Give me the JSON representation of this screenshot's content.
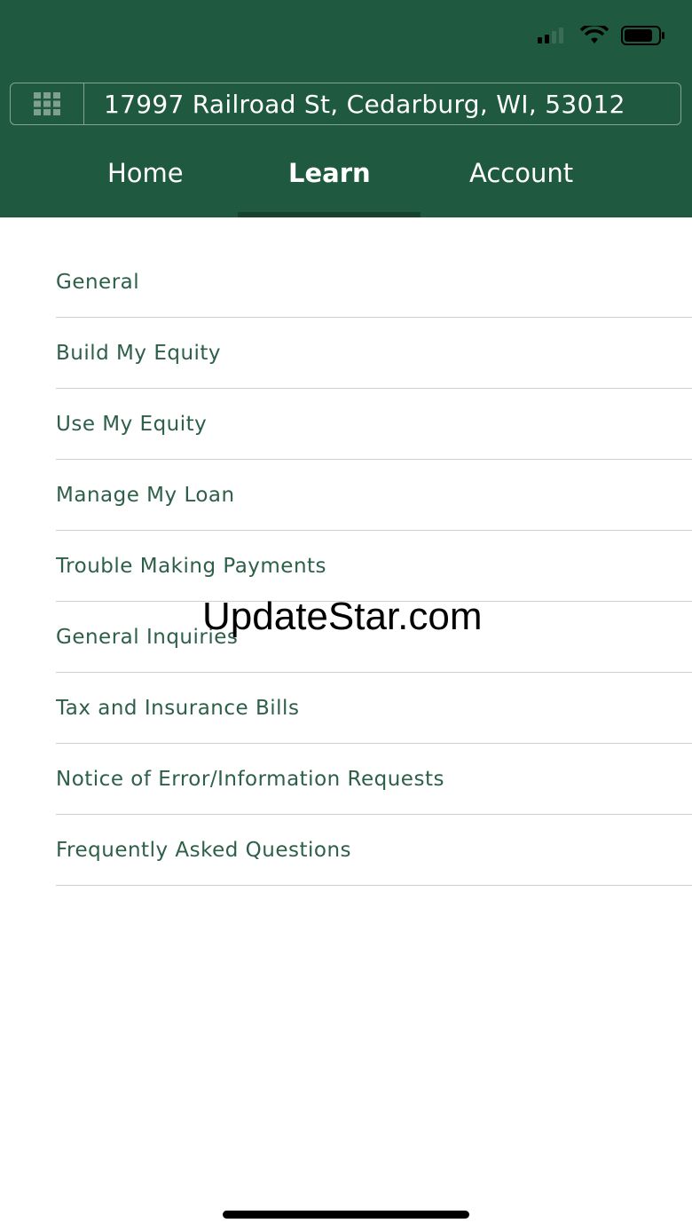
{
  "status_bar": {
    "icons": [
      "cellular-signal-icon",
      "wifi-icon",
      "battery-icon"
    ]
  },
  "header": {
    "address": "17997 Railroad St, Cedarburg, WI, 53012",
    "background_color": "#1f5a40"
  },
  "tabs": [
    {
      "label": "Home",
      "active": false
    },
    {
      "label": "Learn",
      "active": true
    },
    {
      "label": "Account",
      "active": false
    }
  ],
  "learn_topics": [
    "General",
    "Build My Equity",
    "Use My Equity",
    "Manage My Loan",
    "Trouble Making Payments",
    "General Inquiries",
    "Tax and Insurance Bills",
    "Notice of Error/Information Requests",
    "Frequently Asked Questions"
  ],
  "watermark": "UpdateStar.com"
}
